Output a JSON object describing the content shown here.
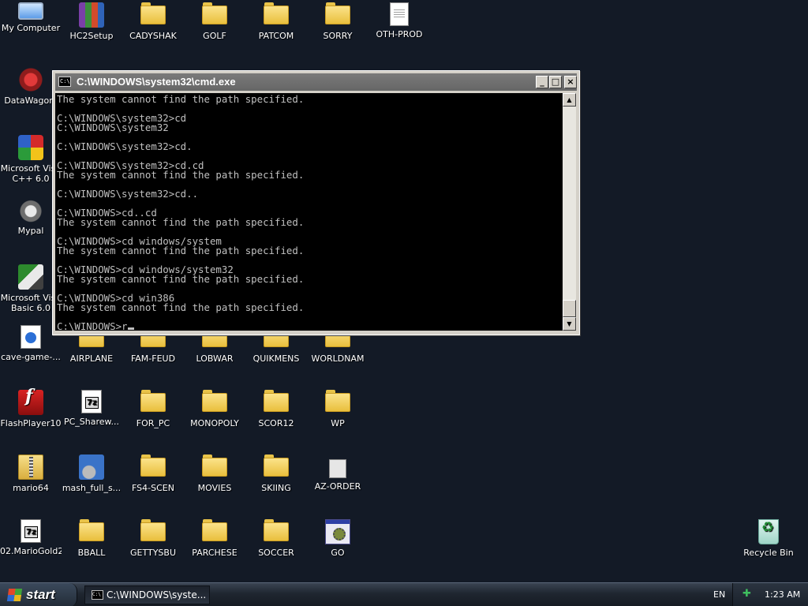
{
  "desktop": {
    "icons": [
      {
        "label": "My Computer",
        "icon": "computer-icon"
      },
      {
        "label": "HC2Setup",
        "icon": "winrar-icon"
      },
      {
        "label": "CADYSHAK",
        "icon": "folder-icon"
      },
      {
        "label": "GOLF",
        "icon": "folder-icon"
      },
      {
        "label": "PATCOM",
        "icon": "folder-icon"
      },
      {
        "label": "SORRY",
        "icon": "folder-icon"
      },
      {
        "label": "OTH-PROD",
        "icon": "document-icon"
      },
      {
        "label": "DataWagon.",
        "icon": "datawagon-icon"
      },
      {
        "label": "Microsoft Visu",
        "label2": "C++ 6.0",
        "icon": "visual-cpp-icon"
      },
      {
        "label": "Mypal",
        "icon": "mypal-icon"
      },
      {
        "label": "Microsoft Visu",
        "label2": "Basic 6.0",
        "icon": "visual-basic-icon"
      },
      {
        "label": "cave-game-...",
        "icon": "media-file-icon"
      },
      {
        "label": "AIRPLANE",
        "icon": "folder-icon"
      },
      {
        "label": "FAM-FEUD",
        "icon": "folder-icon"
      },
      {
        "label": "LOBWAR",
        "icon": "folder-icon"
      },
      {
        "label": "QUIKMENS",
        "icon": "folder-icon"
      },
      {
        "label": "WORLDNAM",
        "icon": "folder-icon"
      },
      {
        "label": "FlashPlayer10",
        "icon": "flash-icon"
      },
      {
        "label": "PC_Sharew...",
        "icon": "archive-7z-icon"
      },
      {
        "label": "FOR_PC",
        "icon": "folder-icon"
      },
      {
        "label": "MONOPOLY",
        "icon": "folder-icon"
      },
      {
        "label": "SCOR12",
        "icon": "folder-icon"
      },
      {
        "label": "WP",
        "icon": "folder-icon"
      },
      {
        "label": "mario64",
        "icon": "zip-icon"
      },
      {
        "label": "mash_full_s...",
        "icon": "setup-icon"
      },
      {
        "label": "FS4-SCEN",
        "icon": "folder-icon"
      },
      {
        "label": "MOVIES",
        "icon": "folder-icon"
      },
      {
        "label": "SKIING",
        "icon": "folder-icon"
      },
      {
        "label": "AZ-ORDER",
        "icon": "file-icon"
      },
      {
        "label": "02.MarioGold2",
        "icon": "archive-7z-icon"
      },
      {
        "label": "BBALL",
        "icon": "folder-icon"
      },
      {
        "label": "GETTYSBU",
        "icon": "folder-icon"
      },
      {
        "label": "PARCHESE",
        "icon": "folder-icon"
      },
      {
        "label": "SOCCER",
        "icon": "folder-icon"
      },
      {
        "label": "GO",
        "icon": "program-icon"
      },
      {
        "label": "Recycle Bin",
        "icon": "recycle-bin-icon"
      }
    ]
  },
  "cmd": {
    "title": "C:\\WINDOWS\\system32\\cmd.exe",
    "minimize": "_",
    "maximize": "□",
    "close": "×",
    "lines": [
      "The system cannot find the path specified.",
      "",
      "C:\\WINDOWS\\system32>cd",
      "C:\\WINDOWS\\system32",
      "",
      "C:\\WINDOWS\\system32>cd.",
      "",
      "C:\\WINDOWS\\system32>cd.cd",
      "The system cannot find the path specified.",
      "",
      "C:\\WINDOWS\\system32>cd..",
      "",
      "C:\\WINDOWS>cd..cd",
      "The system cannot find the path specified.",
      "",
      "C:\\WINDOWS>cd windows/system",
      "The system cannot find the path specified.",
      "",
      "C:\\WINDOWS>cd windows/system32",
      "The system cannot find the path specified.",
      "",
      "C:\\WINDOWS>cd win386",
      "The system cannot find the path specified.",
      ""
    ],
    "prompt": "C:\\WINDOWS>r",
    "scroll_up": "▲",
    "scroll_down": "▼"
  },
  "taskbar": {
    "start_label": "start",
    "task_title": "C:\\WINDOWS\\syste...",
    "language": "EN",
    "clock": "1:23 AM"
  }
}
